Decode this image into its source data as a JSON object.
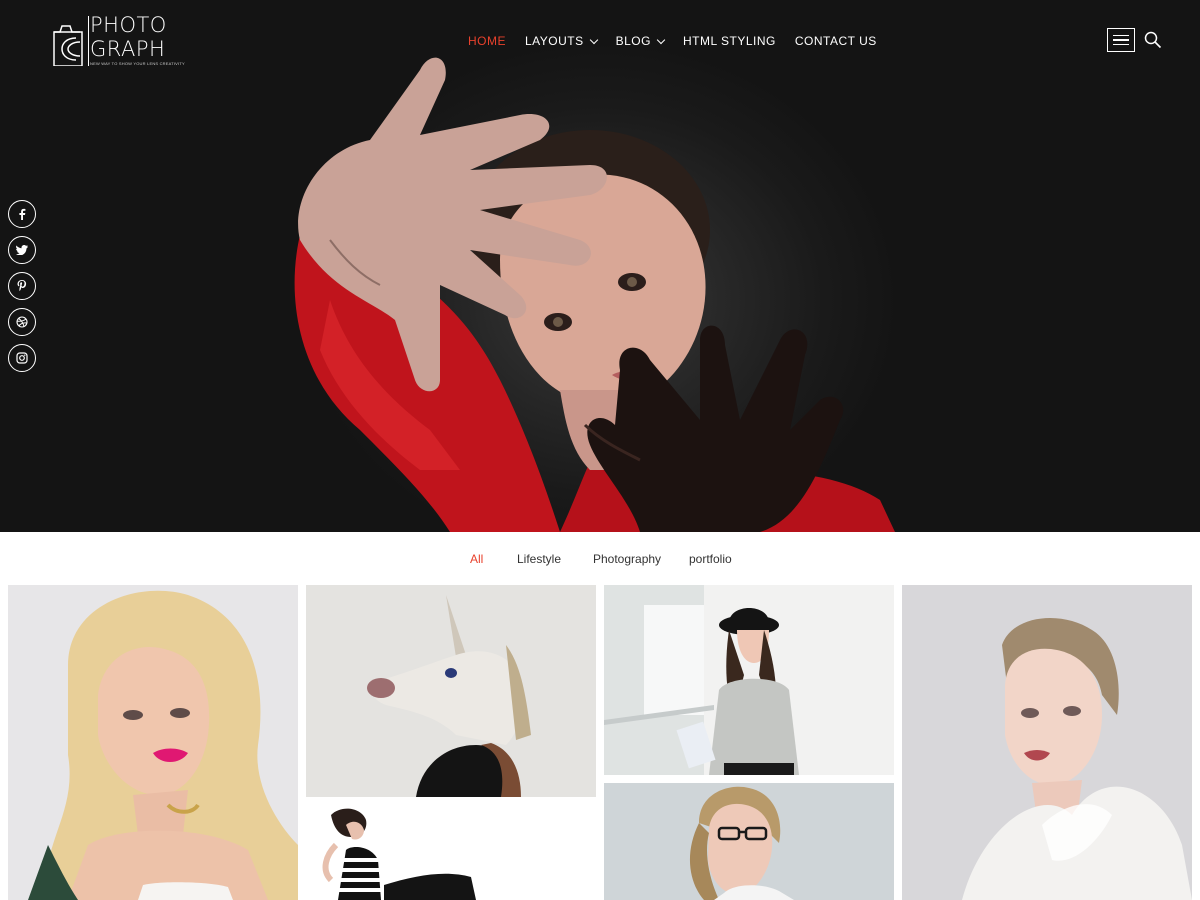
{
  "brand": {
    "line1": "PHOTO",
    "line2": "GRAPH",
    "tagline": "NEW WAY TO SHOW YOUR LENS CREATIVITY"
  },
  "nav": {
    "items": [
      {
        "label": "HOME",
        "active": true,
        "dropdown": false
      },
      {
        "label": "LAYOUTS",
        "active": false,
        "dropdown": true
      },
      {
        "label": "BLOG",
        "active": false,
        "dropdown": true
      },
      {
        "label": "HTML STYLING",
        "active": false,
        "dropdown": false
      },
      {
        "label": "CONTACT US",
        "active": false,
        "dropdown": false
      }
    ],
    "menu_icon": "hamburger-icon",
    "search_icon": "search-icon"
  },
  "social": [
    {
      "name": "facebook-icon",
      "glyph": "f"
    },
    {
      "name": "twitter-icon",
      "glyph": "t"
    },
    {
      "name": "pinterest-icon",
      "glyph": "p"
    },
    {
      "name": "dribbble-icon",
      "glyph": "◎"
    },
    {
      "name": "instagram-icon",
      "glyph": "◻"
    }
  ],
  "filters": [
    {
      "label": "All",
      "active": true
    },
    {
      "label": "Lifestyle",
      "active": false
    },
    {
      "label": "Photography",
      "active": false
    },
    {
      "label": "portfolio",
      "active": false
    }
  ],
  "colors": {
    "accent": "#e8412c",
    "hero_background": "#151515",
    "text": "#333333"
  }
}
